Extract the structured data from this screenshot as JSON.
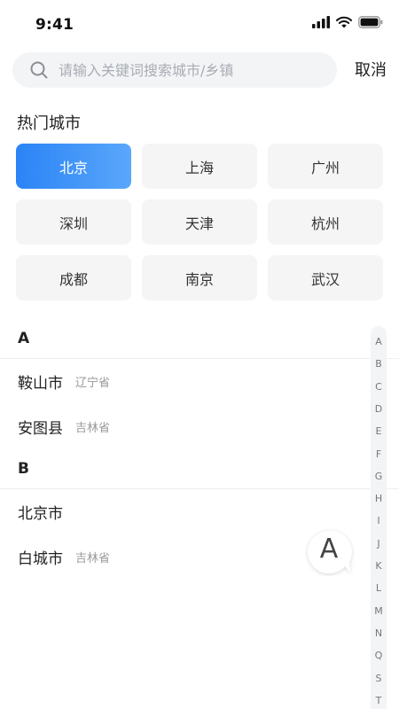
{
  "status": {
    "time": "9:41"
  },
  "search": {
    "placeholder": "请输入关键词搜索城市/乡镇",
    "cancel_label": "取消"
  },
  "hot": {
    "title": "热门城市",
    "cities": [
      "北京",
      "上海",
      "广州",
      "深圳",
      "天津",
      "杭州",
      "成都",
      "南京",
      "武汉"
    ],
    "selected": "北京"
  },
  "groups": [
    {
      "letter": "A",
      "cities": [
        {
          "name": "鞍山市",
          "province": "辽宁省"
        },
        {
          "name": "安图县",
          "province": "吉林省"
        }
      ]
    },
    {
      "letter": "B",
      "cities": [
        {
          "name": "北京市",
          "province": ""
        },
        {
          "name": "白城市",
          "province": "吉林省"
        }
      ]
    }
  ],
  "index": {
    "letters": [
      "A",
      "B",
      "C",
      "D",
      "E",
      "F",
      "G",
      "H",
      "I",
      "J",
      "K",
      "L",
      "M",
      "N",
      "Q",
      "S",
      "T"
    ],
    "active_letter": "A"
  },
  "colors": {
    "accent_start": "#2b84f6",
    "accent_end": "#5aa7fb"
  }
}
